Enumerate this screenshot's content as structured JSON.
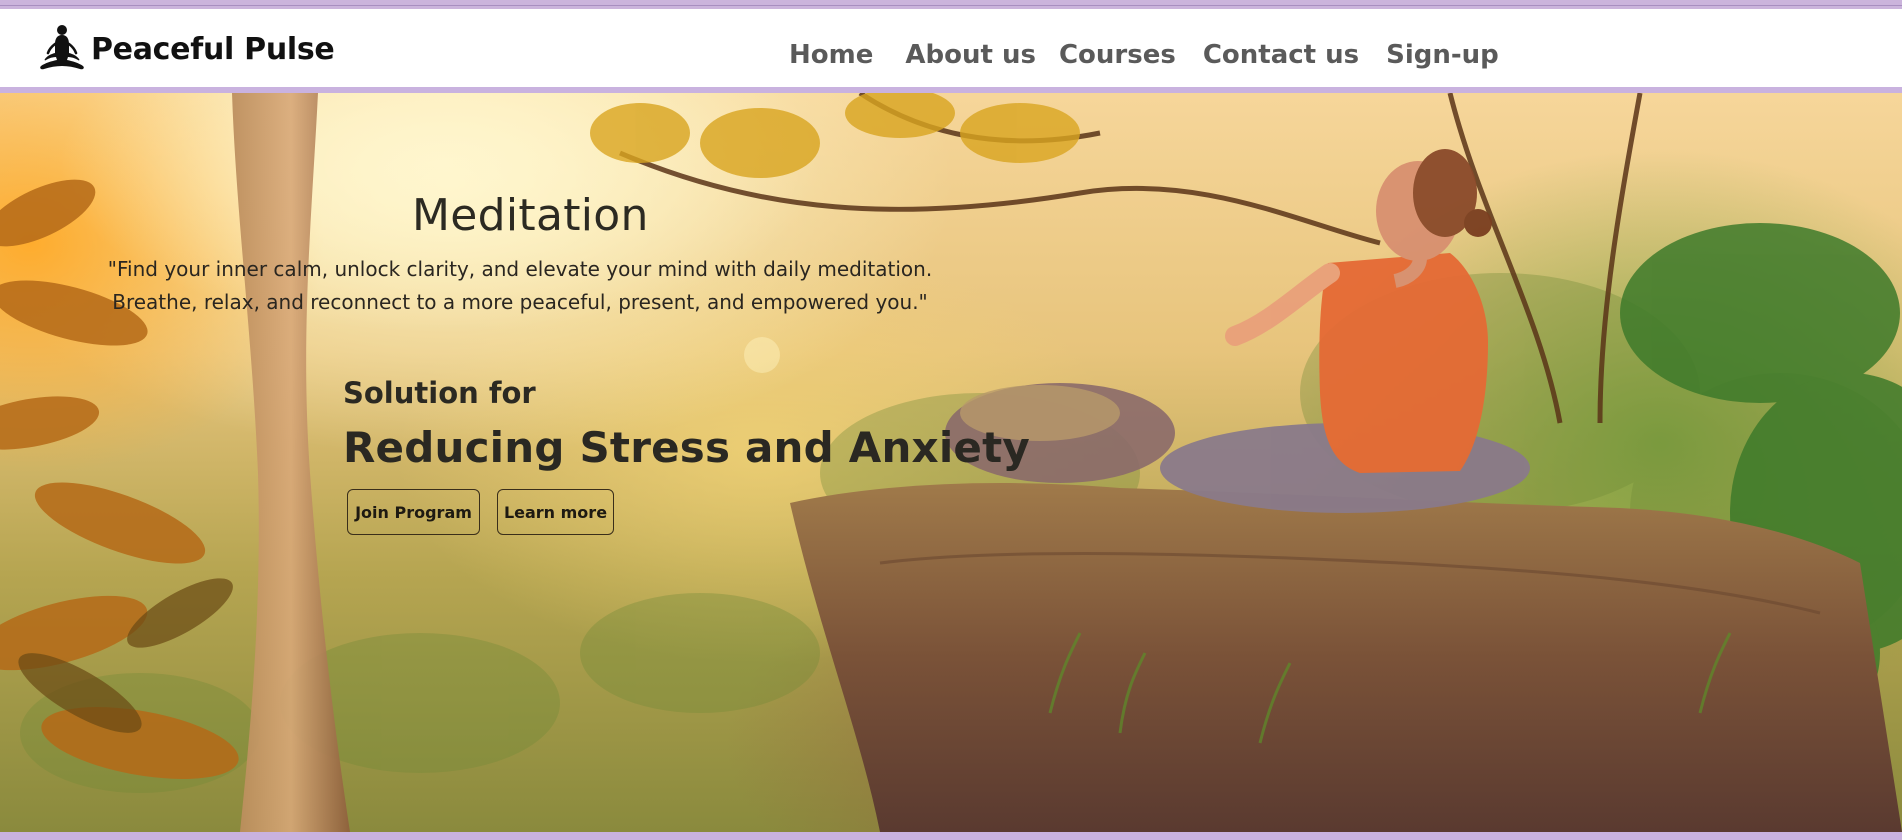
{
  "brand": {
    "name": "Peaceful Pulse",
    "logo_icon": "meditating-person-icon"
  },
  "nav": {
    "links": [
      "Home",
      "About us",
      "Courses",
      "Contact us",
      "Sign-up"
    ]
  },
  "hero": {
    "title": "Meditation",
    "quote_line1": "\"Find your inner calm, unlock clarity, and elevate your mind with daily meditation.",
    "quote_line2": "Breathe, relax, and reconnect to a more peaceful, present, and empowered you.\"",
    "subheading": "Solution for",
    "headline": "Reducing Stress and Anxiety",
    "buttons": {
      "join": "Join Program",
      "learn": "Learn more"
    },
    "background_image": "woman-meditating-on-cliff-in-forest"
  },
  "colors": {
    "accent_border": "#c9b2df",
    "nav_text": "#5a5a5a",
    "brand_text": "#111111"
  }
}
